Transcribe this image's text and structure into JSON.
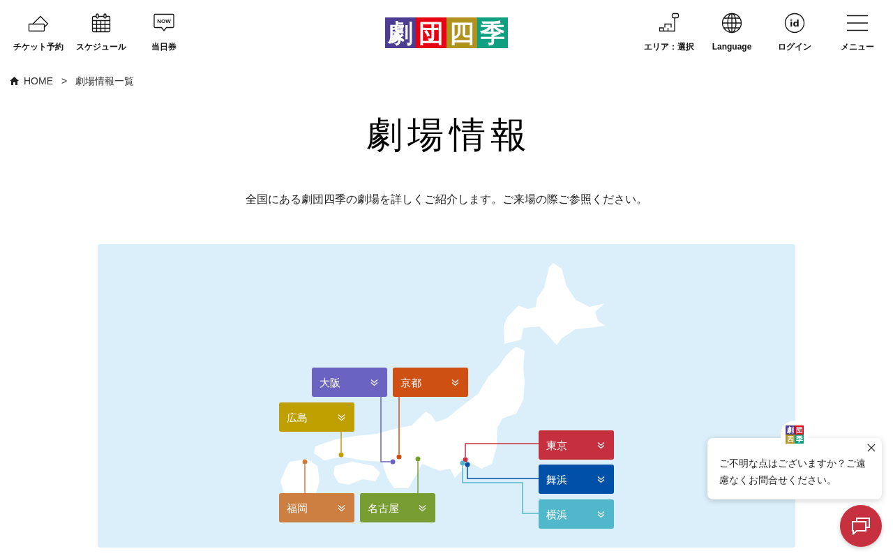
{
  "header": {
    "nav_left": [
      {
        "kind": "ticket",
        "label": "チケット予約"
      },
      {
        "kind": "calendar",
        "label": "スケジュール"
      },
      {
        "kind": "now",
        "label": "当日券",
        "icon_text": "NOW"
      }
    ],
    "logo": [
      {
        "char": "劇",
        "color": "#4c3d91"
      },
      {
        "char": "団",
        "color": "#e60012"
      },
      {
        "char": "四",
        "color": "#b0931c"
      },
      {
        "char": "季",
        "color": "#10a081"
      }
    ],
    "nav_right": [
      {
        "kind": "area",
        "label": "エリア：選択"
      },
      {
        "kind": "globe",
        "label": "Language"
      },
      {
        "kind": "login",
        "label": "ログイン",
        "icon_text": "id"
      },
      {
        "kind": "menu",
        "label": "メニュー"
      }
    ]
  },
  "breadcrumb": {
    "items": [
      {
        "kind": "home",
        "label": "HOME"
      },
      {
        "kind": "current",
        "label": "劇場情報一覧"
      }
    ],
    "separator": ">"
  },
  "title": "劇場情報",
  "description": "全国にある劇団四季の劇場を詳しくご紹介します。ご来場の際ご参照ください。",
  "theater_map": {
    "regions": [
      {
        "label": "大阪",
        "color": "#6b63c2"
      },
      {
        "label": "京都",
        "color": "#cf5013"
      },
      {
        "label": "広島",
        "color": "#bf9e00"
      },
      {
        "label": "東京",
        "color": "#c6303e"
      },
      {
        "label": "舞浜",
        "color": "#0050a7"
      },
      {
        "label": "福岡",
        "color": "#cc7f40"
      },
      {
        "label": "名古屋",
        "color": "#789d33"
      },
      {
        "label": "横浜",
        "color": "#51b8cc"
      }
    ]
  },
  "chat": {
    "avatar_logo": [
      {
        "char": "劇",
        "color": "#4c3d91"
      },
      {
        "char": "団",
        "color": "#e60012"
      },
      {
        "char": "四",
        "color": "#b0931c"
      },
      {
        "char": "季",
        "color": "#10a081"
      }
    ],
    "message": "ご不明な点はございますか？ご遠慮なくお問合せください。"
  }
}
